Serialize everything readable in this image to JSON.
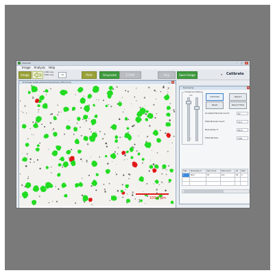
{
  "window": {
    "title": "pheno4x",
    "minimize": "–",
    "maximize": "□",
    "close": "✕"
  },
  "menu": [
    "Image",
    "Analysis",
    "Help"
  ],
  "toolbar": {
    "image_label": "Image",
    "options": [
      "1 RBC lines",
      "2 RBC lines"
    ],
    "value": "20",
    "print_label": "Print",
    "gray_level_label": "Grayscale",
    "live_label": "Live",
    "stop_label": "Stop",
    "save_image_label": "Save Image",
    "calibrate_label": "Calibrate"
  },
  "image_window": {
    "title": "D:\\Image Gallery\\Nodularity\\sample_0001.bmp",
    "scale_label": "100.0 µm"
  },
  "results_window": {
    "title": "Nodularity",
    "threshold_label": "Threshold Setting",
    "slider_min": "0",
    "slider_max": "255",
    "buttons": {
      "calibrate": "Calibrate",
      "report": "Report",
      "reset": "Reset",
      "report_total": "Report Total"
    },
    "stats": [
      {
        "label": "Accepted Nodule Count",
        "value": "87"
      },
      {
        "label": "Total Nodule Count",
        "value": "112"
      },
      {
        "label": "Nodularity %",
        "value": "80.6"
      },
      {
        "label": "Total Particle",
        "value": "128"
      }
    ],
    "table": {
      "headers": [
        "S.No",
        "Nodularity %",
        "Nod Count",
        "Total Count",
        "Sd",
        "Total"
      ],
      "rows": [
        [
          "1",
          "80.6",
          "87",
          "112",
          "85",
          "0"
        ]
      ]
    }
  },
  "colors": {
    "accent_green": "#3f9a3f",
    "nodule_red": "#e01818",
    "nodule_green": "#22dc22",
    "background": "#7a7a7a"
  }
}
